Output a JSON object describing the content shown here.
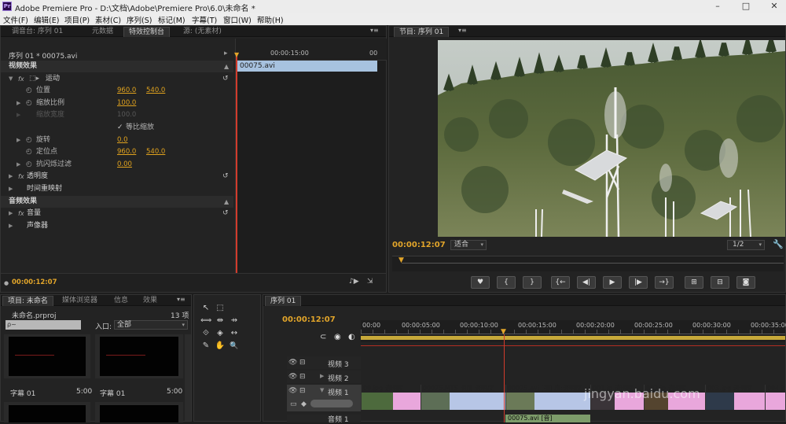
{
  "titlebar": {
    "app_logo": "Pr",
    "title": "Adobe Premiere Pro - D:\\文档\\Adobe\\Premiere Pro\\6.0\\未命名 *"
  },
  "menu": [
    "文件(F)",
    "编辑(E)",
    "项目(P)",
    "素材(C)",
    "序列(S)",
    "标记(M)",
    "字幕(T)",
    "窗口(W)",
    "帮助(H)"
  ],
  "source_panel": {
    "tabs": [
      "调音台: 序列 01",
      "元数据",
      "特效控制台",
      "源: (无素材)"
    ],
    "active_tab": "特效控制台",
    "sequence_label": "序列 01 * 00075.avi",
    "ruler_labels": [
      "00:00:15:00",
      "00"
    ],
    "clip_label": "00075.avi",
    "video_effects_header": "视频效果",
    "motion": "运动",
    "position_label": "位置",
    "position_x": "960.0",
    "position_y": "540.0",
    "scale_label": "缩放比例",
    "scale_val": "100.0",
    "scale_width_label": "缩放宽度",
    "scale_width_val": "100.0",
    "uniform_label": "等比缩放",
    "rotation_label": "旋转",
    "rotation_val": "0.0",
    "anchor_label": "定位点",
    "anchor_x": "960.0",
    "anchor_y": "540.0",
    "antiflicker_label": "抗闪烁过滤",
    "antiflicker_val": "0.00",
    "opacity": "透明度",
    "time_remap": "时间重映射",
    "audio_effects_header": "音频效果",
    "volume": "音量",
    "panner": "声像器",
    "timecode": "00:00:12:07"
  },
  "program_monitor": {
    "tab": "节目: 序列 01",
    "timecode": "00:00:12:07",
    "fit": "适合",
    "resolution": "1/2",
    "controls": [
      "♥",
      "{",
      "}",
      "{←",
      "◀|",
      "▶",
      "|▶",
      "→}",
      "⊞",
      "⊟",
      "◙"
    ]
  },
  "project_panel": {
    "tabs": [
      "项目: 未命名",
      "媒体浏览器",
      "信息",
      "效果"
    ],
    "project_name": "未命名.prproj",
    "item_count": "13 项",
    "search_placeholder": "ρ~",
    "in_label": "入口:",
    "in_value": "全部",
    "items": [
      {
        "name": "字幕 01",
        "dur": "5:00"
      },
      {
        "name": "字幕 01",
        "dur": "5:00"
      }
    ]
  },
  "tools": [
    "↖",
    "⬚",
    "⟺",
    "⇹",
    "⇸",
    "⟐",
    "◈",
    "↔",
    "✎",
    "✋",
    "🔍"
  ],
  "timeline": {
    "tab": "序列 01",
    "timecode": "00:00:12:07",
    "ruler": [
      "00:00",
      "00:00:05:00",
      "00:00:10:00",
      "00:00:15:00",
      "00:00:20:00",
      "00:00:25:00",
      "00:00:30:00",
      "00:00:35:00"
    ],
    "tracks": [
      "视频 3",
      "视频 2",
      "视频 1",
      "音频 1"
    ],
    "clips": [
      {
        "label": "00.jpg 透明度",
        "color": "#e9a7dc"
      },
      {
        "label": "00075.MTS 明度 透明度",
        "color": "#9fb1dc"
      },
      {
        "label": "00075.avi [视] 度:透明度",
        "color": "#9fb1dc"
      },
      {
        "label": "001.jp 透明度",
        "color": "#e9a7dc"
      },
      {
        "label": "002.jp 透明度",
        "color": "#e9a7dc"
      },
      {
        "label": "003.jpg 透明度",
        "color": "#e9a7dc"
      },
      {
        "label": "004.jp",
        "color": "#e9a7dc"
      }
    ],
    "audio_clip": "00075.avi [音]",
    "watermark": "jingyan.baidu.com"
  },
  "colors": {
    "accent": "#e2a52a",
    "playhead": "#d13b2c",
    "audio_clip": "#7d9c6a"
  }
}
